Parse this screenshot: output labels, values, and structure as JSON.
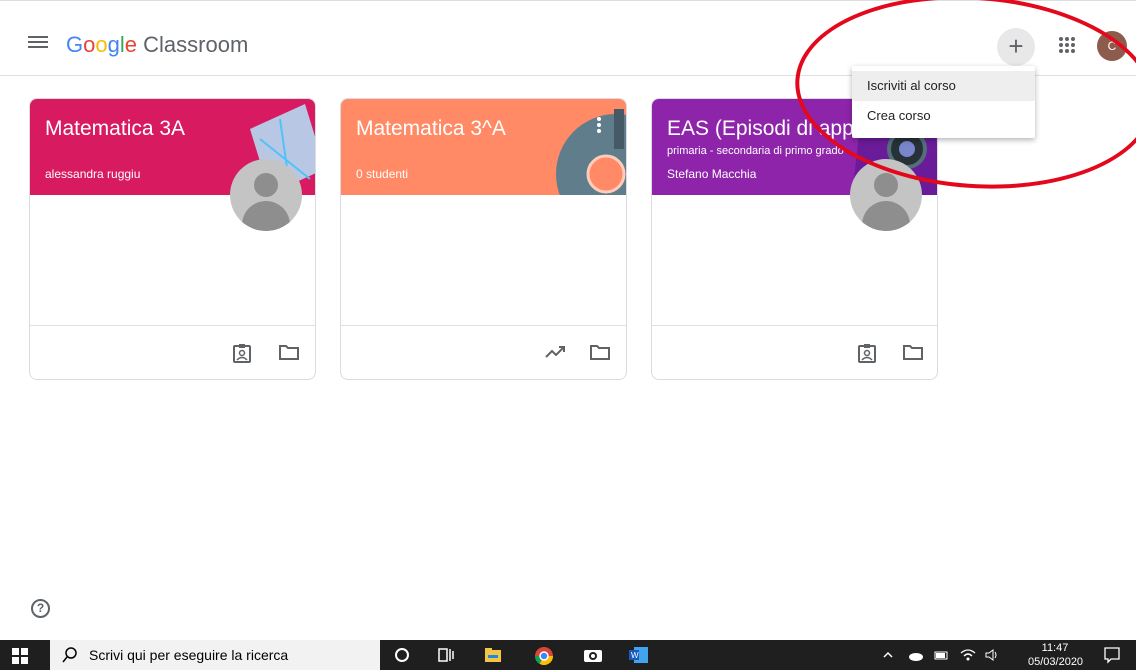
{
  "app": {
    "logo_letters": [
      {
        "ch": "G",
        "color": "#4285F4"
      },
      {
        "ch": "o",
        "color": "#EA4335"
      },
      {
        "ch": "o",
        "color": "#FBBC05"
      },
      {
        "ch": "g",
        "color": "#4285F4"
      },
      {
        "ch": "l",
        "color": "#34A853"
      },
      {
        "ch": "e",
        "color": "#EA4335"
      }
    ],
    "product_name": "Classroom",
    "account_initial": "C",
    "plus_label": "+"
  },
  "menu": {
    "items": [
      "Iscriviti al corso",
      "Crea corso"
    ]
  },
  "cards": [
    {
      "title": "Matematica 3A",
      "subtitle": "alessandra ruggiu",
      "secondary": "",
      "color": "#d81b60",
      "footer_icons": [
        "assignment-ind-icon",
        "folder-icon"
      ]
    },
    {
      "title": "Matematica 3^A",
      "subtitle": "0 studenti",
      "secondary": "",
      "color": "#ff8a65",
      "footer_icons": [
        "trending-up-icon",
        "folder-icon"
      ]
    },
    {
      "title": "EAS (Episodi di appr",
      "subtitle": "Stefano Macchia",
      "secondary": "primaria - secondaria di primo grado",
      "color": "#8e24aa",
      "footer_icons": [
        "assignment-ind-icon",
        "folder-icon"
      ]
    }
  ],
  "help": {
    "label": "?"
  },
  "taskbar": {
    "search_placeholder": "Scrivi qui per eseguire la ricerca",
    "time": "11:47",
    "date": "05/03/2020"
  }
}
